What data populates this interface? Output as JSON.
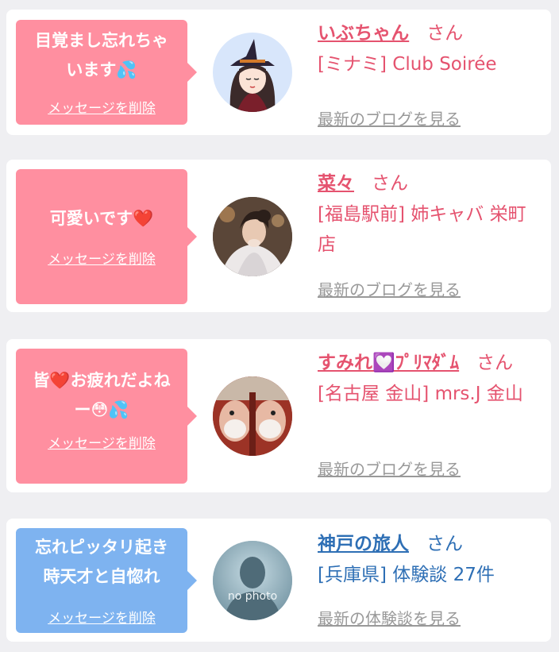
{
  "colors": {
    "pink_bubble": "#ff8fa0",
    "blue_bubble": "#7eb3f0",
    "pink_text": "#e5536f",
    "blue_text": "#2e6fb5",
    "link_gray": "#999999"
  },
  "cards": [
    {
      "message_lines": [
        "目覚まし忘れちゃ",
        "います💦"
      ],
      "delete_label": "メッセージを削除",
      "avatar_icon": "witch-avatar",
      "name": "いぶちゃん",
      "honorific": "さん",
      "sub": "[ミナミ] Club Soirée",
      "more_label": "最新のブログを見る"
    },
    {
      "message_lines": [
        "可愛いです❤️"
      ],
      "delete_label": "メッセージを削除",
      "avatar_icon": "kimono-photo-avatar",
      "name": "菜々",
      "honorific": "さん",
      "sub": "[福島駅前] 姉キャバ 栄町店",
      "more_label": "最新のブログを見る"
    },
    {
      "message_lines": [
        "皆❤️お疲れだよね",
        "ー😳💦"
      ],
      "delete_label": "メッセージを削除",
      "avatar_icon": "mirror-face-avatar",
      "name": "すみれ💟ﾌﾟﾘﾏﾀﾞﾑ",
      "honorific": "さん",
      "sub": "[名古屋 金山] mrs.J 金山",
      "more_label": "最新のブログを見る"
    },
    {
      "message_lines": [
        "忘れピッタリ起き",
        "時天才と自惚れ"
      ],
      "delete_label": "メッセージを削除",
      "avatar_icon": "no-photo-avatar",
      "avatar_caption": "no photo",
      "name": "神戸の旅人",
      "honorific": "さん",
      "sub": "[兵庫県] 体験談 27件",
      "more_label": "最新の体験談を見る"
    }
  ]
}
